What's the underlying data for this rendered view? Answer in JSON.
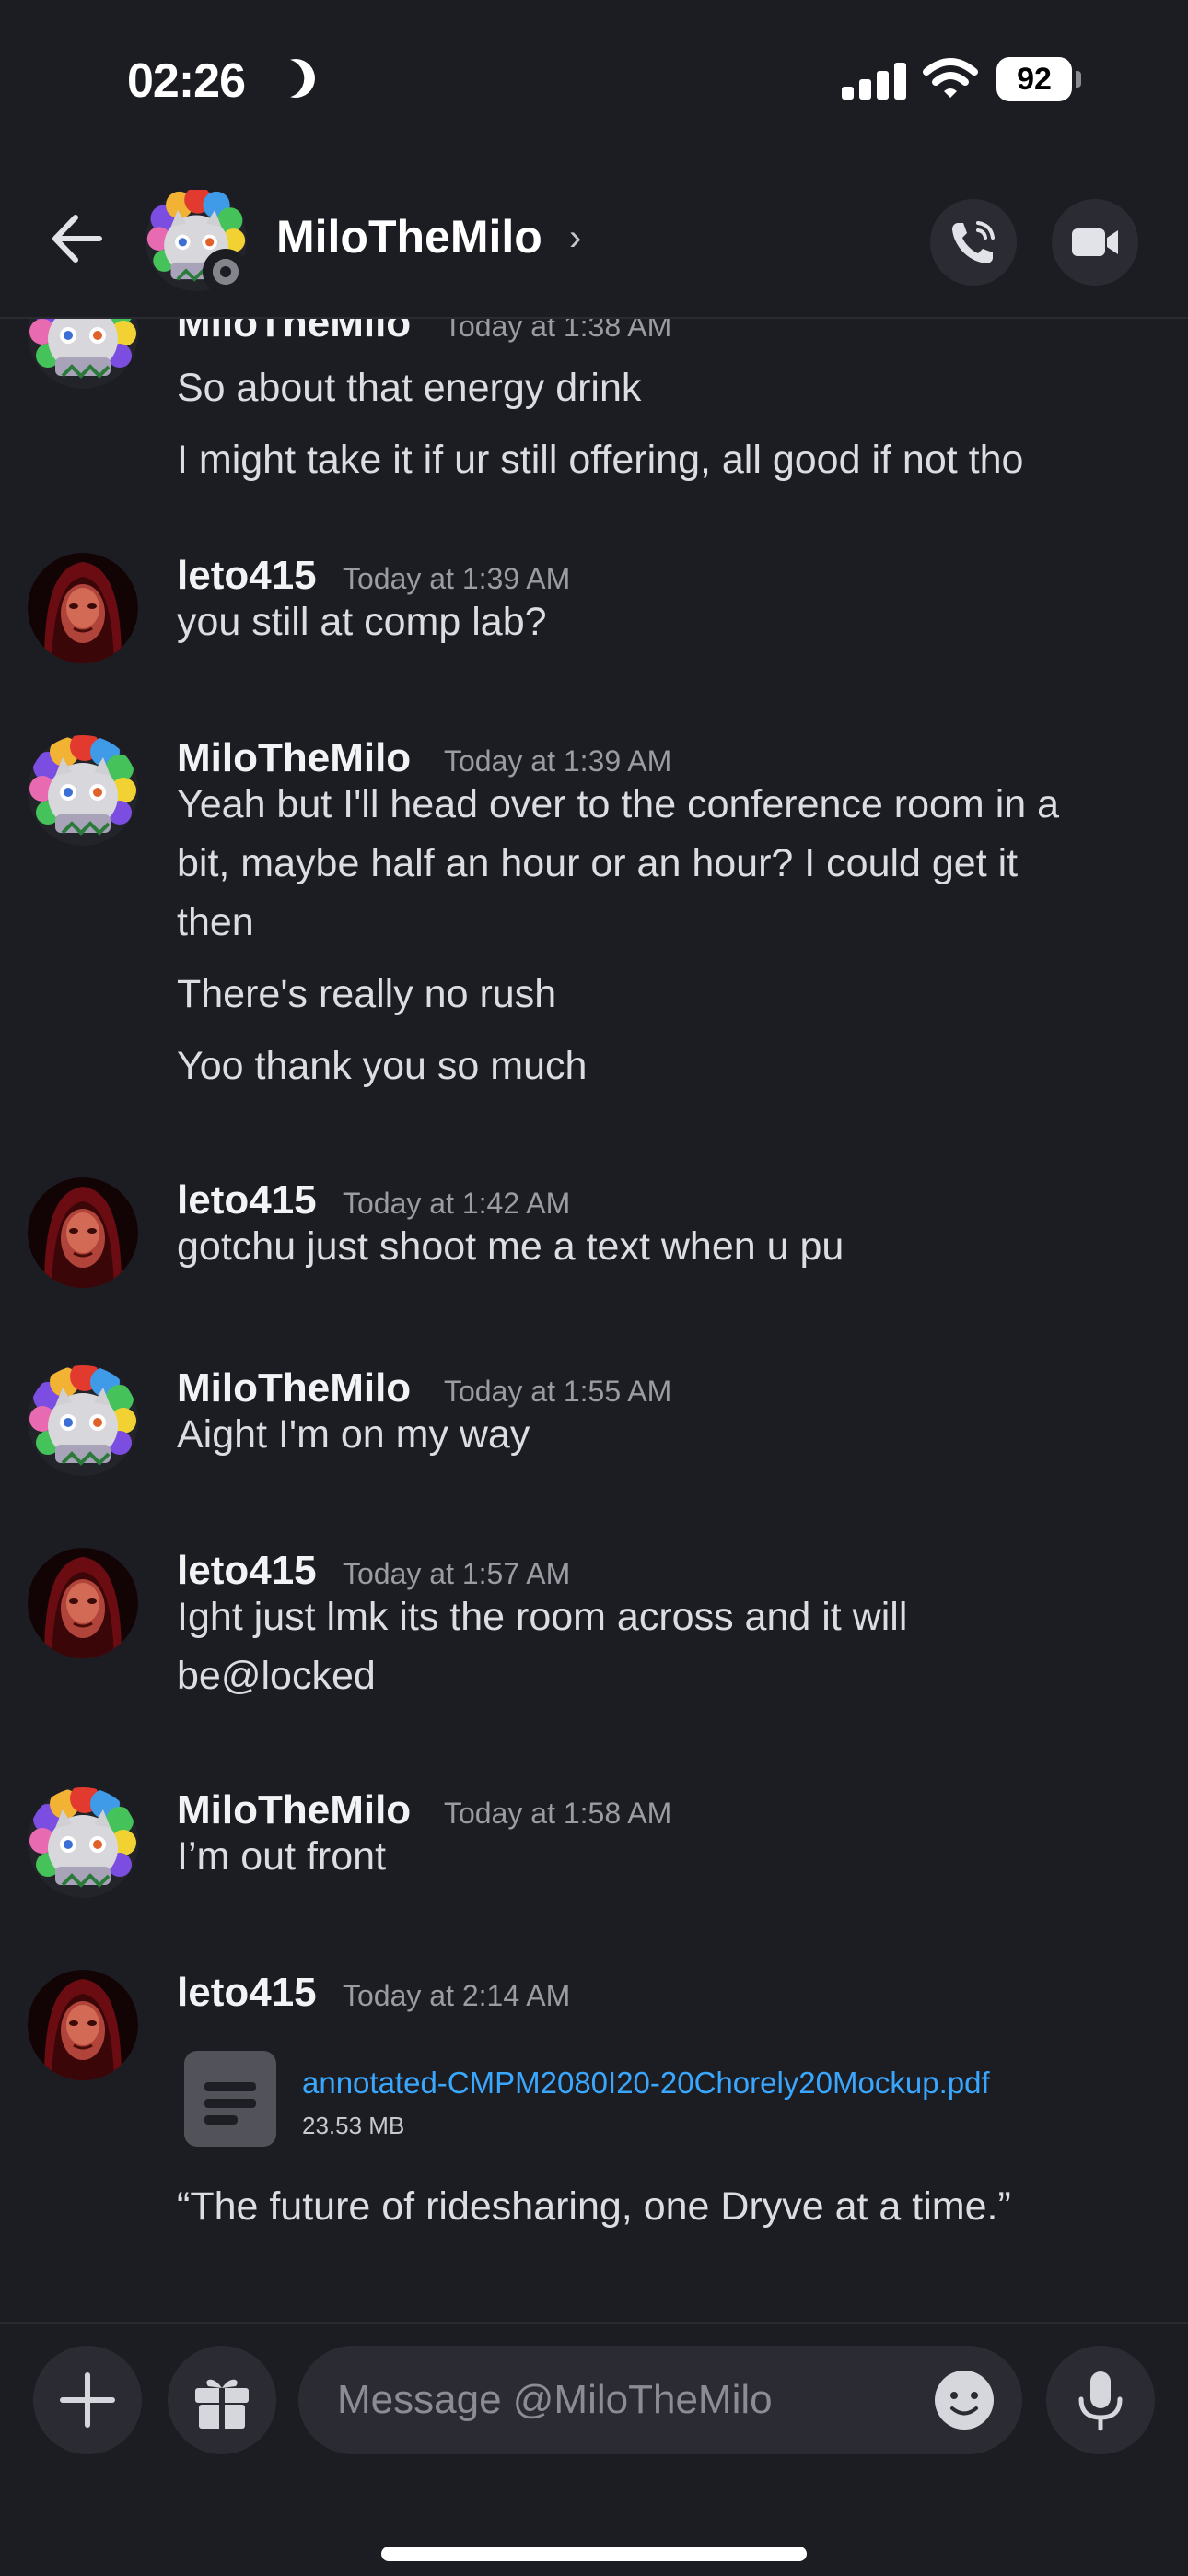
{
  "status_bar": {
    "time": "02:26",
    "battery": "92"
  },
  "header": {
    "name": "MiloTheMilo",
    "chevron": "›"
  },
  "messages": [
    {
      "author": "MiloTheMilo",
      "time": "Today at 1:38 AM",
      "lines": [
        "So about that energy drink",
        "I might take it if ur still offering, all good if not tho"
      ]
    },
    {
      "author": "leto415",
      "time": "Today at 1:39 AM",
      "lines": [
        "you still at comp lab?"
      ]
    },
    {
      "author": "MiloTheMilo",
      "time": "Today at 1:39 AM",
      "lines": [
        "Yeah but I'll head over to the conference room in a",
        "bit, maybe half an hour or an hour? I could get it",
        "then",
        "There's really no rush",
        "Yoo thank you so much"
      ]
    },
    {
      "author": "leto415",
      "time": "Today at 1:42 AM",
      "lines": [
        "gotchu just shoot me a text when u pu"
      ]
    },
    {
      "author": "MiloTheMilo",
      "time": "Today at 1:55 AM",
      "lines": [
        "Aight I'm on my way"
      ]
    },
    {
      "author": "leto415",
      "time": "Today at 1:57 AM",
      "lines": [
        "Ight just lmk its the room across and it will",
        "be@locked"
      ]
    },
    {
      "author": "MiloTheMilo",
      "time": "Today at 1:58 AM",
      "lines": [
        "I’m out front"
      ]
    },
    {
      "author": "leto415",
      "time": "Today at 2:14 AM",
      "attachment": {
        "name": "annotated-CMPM2080I20-20Chorely20Mockup.pdf",
        "size": "23.53 MB"
      },
      "lines": [
        "“The future of ridesharing, one Dryve at a time.”"
      ]
    }
  ],
  "composer": {
    "placeholder": "Message @MiloTheMilo"
  },
  "icons": {
    "back": "arrow-left-icon",
    "call": "phone-call-icon",
    "video": "video-camera-icon",
    "plus": "plus-icon",
    "gift": "gift-icon",
    "emoji": "emoji-icon",
    "mic": "microphone-icon",
    "file": "document-file-icon",
    "moon": "moon-icon",
    "signal": "cellular-signal-icon",
    "wifi": "wifi-icon"
  },
  "colors": {
    "background": "#1c1d22",
    "link": "#3aa7ff",
    "surface": "#2b2c33"
  }
}
